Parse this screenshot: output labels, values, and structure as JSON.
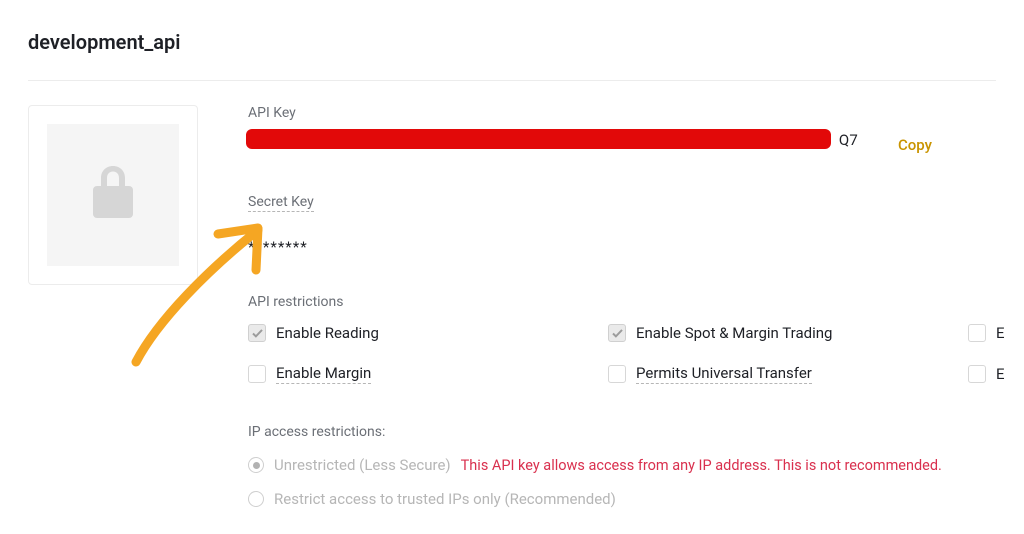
{
  "title": "development_api",
  "apiKey": {
    "label": "API Key",
    "visibleTail": "Q7",
    "copyLabel": "Copy"
  },
  "secretKey": {
    "label": "Secret Key",
    "value": "********"
  },
  "restrictions": {
    "label": "API restrictions",
    "items": [
      {
        "label": "Enable Reading",
        "checked": true,
        "dashed": false
      },
      {
        "label": "Enable Spot & Margin Trading",
        "checked": true,
        "dashed": false
      },
      {
        "label": "E",
        "checked": false,
        "dashed": false
      },
      {
        "label": "Enable Margin",
        "checked": false,
        "dashed": true
      },
      {
        "label": "Permits Universal Transfer",
        "checked": false,
        "dashed": true
      },
      {
        "label": "E",
        "checked": false,
        "dashed": false
      }
    ]
  },
  "ipAccess": {
    "label": "IP access restrictions:",
    "options": [
      {
        "label": "Unrestricted (Less Secure)",
        "selected": true,
        "warning": "This API key allows access from any IP address. This is not recommended."
      },
      {
        "label": "Restrict access to trusted IPs only (Recommended)",
        "selected": false,
        "warning": ""
      }
    ]
  },
  "colors": {
    "accent": "#c99400",
    "danger": "#d9304e",
    "redaction": "#e20909",
    "arrow": "#f5a623"
  }
}
